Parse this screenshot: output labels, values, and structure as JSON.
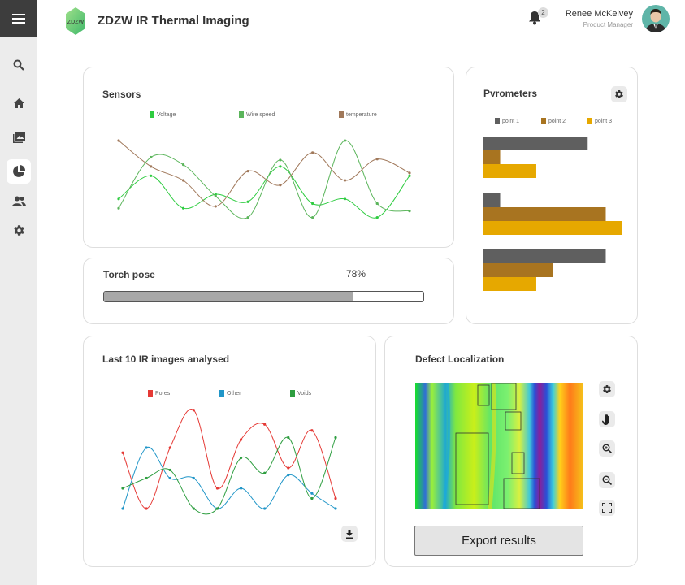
{
  "app": {
    "title": "ZDZW IR Thermal Imaging",
    "logo_text": "ZDZW",
    "notifications": "2",
    "user_name": "Renee McKelvey",
    "user_role": "Product Manager"
  },
  "sidebar": {
    "items": [
      {
        "name": "search",
        "icon": "search-icon"
      },
      {
        "name": "home",
        "icon": "home-icon"
      },
      {
        "name": "images",
        "icon": "gallery-icon"
      },
      {
        "name": "analytics",
        "icon": "pie-chart-icon",
        "active": true
      },
      {
        "name": "users",
        "icon": "users-icon"
      },
      {
        "name": "settings",
        "icon": "gear-icon"
      }
    ]
  },
  "sensors": {
    "title": "Sensors",
    "chart_data": {
      "type": "line",
      "x": [
        1,
        2,
        3,
        4,
        5,
        6,
        7,
        8,
        9,
        10
      ],
      "series": [
        {
          "name": "Voltage",
          "color": "#2ecc40",
          "values": [
            0.3,
            0.55,
            0.2,
            0.35,
            0.27,
            0.65,
            0.25,
            0.3,
            0.1,
            0.55
          ]
        },
        {
          "name": "Wire speed",
          "color": "#5bb55b",
          "values": [
            0.2,
            0.75,
            0.67,
            0.33,
            0.1,
            0.72,
            0.1,
            0.93,
            0.25,
            0.17
          ]
        },
        {
          "name": "temperature",
          "color": "#a0785a",
          "values": [
            0.93,
            0.65,
            0.5,
            0.22,
            0.6,
            0.45,
            0.8,
            0.5,
            0.73,
            0.58
          ]
        }
      ]
    }
  },
  "torch": {
    "title": "Torch pose",
    "percent_label": "78%",
    "percent": 78
  },
  "pyrometers": {
    "title": "Pvrometers",
    "chart_data": {
      "type": "bar",
      "orientation": "horizontal",
      "series": [
        {
          "name": "point 1",
          "color": "#5f5f5f",
          "values": [
            0.75,
            0.12,
            0.88
          ]
        },
        {
          "name": "point 2",
          "color": "#a87420",
          "values": [
            0.12,
            0.88,
            0.5
          ]
        },
        {
          "name": "point 3",
          "color": "#e6a800",
          "values": [
            0.38,
            1.0,
            0.38
          ]
        }
      ]
    }
  },
  "ir_images": {
    "title": "Last 10 IR images analysed",
    "chart_data": {
      "type": "line",
      "x": [
        1,
        2,
        3,
        4,
        5,
        6,
        7,
        8,
        9,
        10
      ],
      "series": [
        {
          "name": "Pores",
          "color": "#e53935",
          "values": [
            0.55,
            0.0,
            0.6,
            0.97,
            0.2,
            0.68,
            0.83,
            0.4,
            0.77,
            0.1
          ]
        },
        {
          "name": "Other",
          "color": "#2196c8",
          "values": [
            0.0,
            0.6,
            0.3,
            0.3,
            0.0,
            0.2,
            0.0,
            0.33,
            0.15,
            0.0
          ]
        },
        {
          "name": "Voids",
          "color": "#2e9e40",
          "values": [
            0.2,
            0.3,
            0.38,
            0.0,
            0.0,
            0.5,
            0.35,
            0.7,
            0.1,
            0.7
          ]
        }
      ]
    }
  },
  "defect": {
    "title": "Defect Localization",
    "export_label": "Export results",
    "tools": [
      "gear-icon",
      "hand-icon",
      "zoom-in-icon",
      "zoom-out-icon",
      "fullscreen-icon"
    ]
  }
}
